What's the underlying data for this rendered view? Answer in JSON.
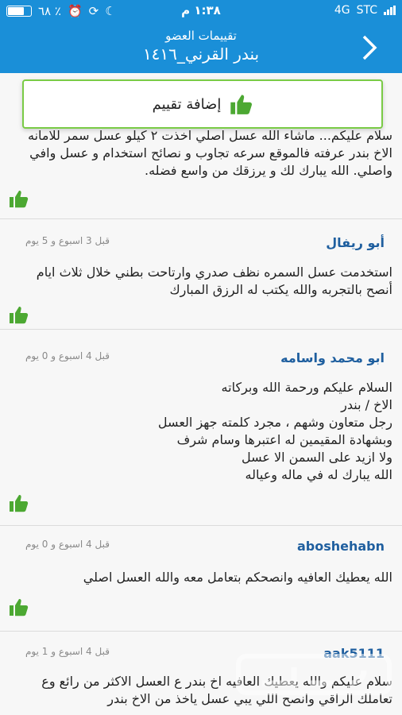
{
  "status_bar": {
    "time": "١:٣٨ م",
    "battery_label": "٦٨ ٪",
    "battery_level": 0.68,
    "network": "4G",
    "carrier": "STC"
  },
  "header": {
    "subtitle": "تقييمات العضو",
    "title": "بندر القرني_١٤١٦"
  },
  "add_review": {
    "label": "إضافة تقييم"
  },
  "reviews": [
    {
      "author": "",
      "date": "",
      "lines": [
        "سلام عليكم... ماشاء الله عسل اصلي اخذت ٢ كيلو عسل سمر للامانه",
        "الاخ بندر عرفته فالموقع سرعه تجاوب و نصائح استخدام و عسل وافي",
        "واصلي. الله يبارك لك و يرزقك من واسع فضله."
      ]
    },
    {
      "author": "أبو ريفال",
      "date": "قبل 3 اسبوع و 5 يوم",
      "lines": [
        "استخدمت عسل السمره نظف صدري وارتاحت بطني خلال ثلاث ايام",
        "أنصح بالتجربه والله يكتب له الرزق المبارك"
      ]
    },
    {
      "author": "ابو محمد واسامه",
      "date": "قبل 4 اسبوع و 0 يوم",
      "lines": [
        "السلام عليكم ورحمة الله وبركاته",
        "الاخ / بندر",
        "رجل متعاون وشهم ، مجرد كلمته جهز العسل",
        "وبشهادة المقيمين له اعتبرها وسام شرف",
        "ولا ازيد على السمن الا عسل",
        "الله يبارك له في ماله وعياله"
      ]
    },
    {
      "author": "aboshehabn",
      "date": "قبل 4 اسبوع و 0 يوم",
      "lines": [
        "الله يعطيك العافيه وانصحكم بتعامل معه والله العسل اصلي"
      ]
    },
    {
      "author": "aak5111",
      "date": "قبل 4 اسبوع و 1 يوم",
      "lines": [
        "سلام عليكم والله يعطيك العافيه اخ بندر ع العسل الاكثر من رائع وع",
        "تعاملك الراقي وانصح اللي يبي عسل ياخذ من الاخ بندر"
      ]
    }
  ],
  "watermark": "حراج",
  "colors": {
    "header": "#1a8fd8",
    "accent_green": "#4ca832",
    "author": "#1f5f9f"
  }
}
